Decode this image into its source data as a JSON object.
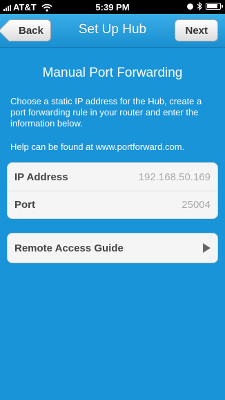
{
  "status_bar": {
    "carrier": "AT&T",
    "time": "5:39 PM",
    "battery_level": 0.85
  },
  "nav": {
    "back_label": "Back",
    "title": "Set Up Hub",
    "next_label": "Next"
  },
  "main": {
    "heading": "Manual Port Forwarding",
    "description": "Choose a static IP address for the Hub, create a port forwarding rule in your router and enter the information below.",
    "help": "Help can be found at www.portforward.com.",
    "fields": [
      {
        "label": "IP Address",
        "value": "192.168.50.169"
      },
      {
        "label": "Port",
        "value": "25004"
      }
    ],
    "guide_label": "Remote Access Guide"
  }
}
